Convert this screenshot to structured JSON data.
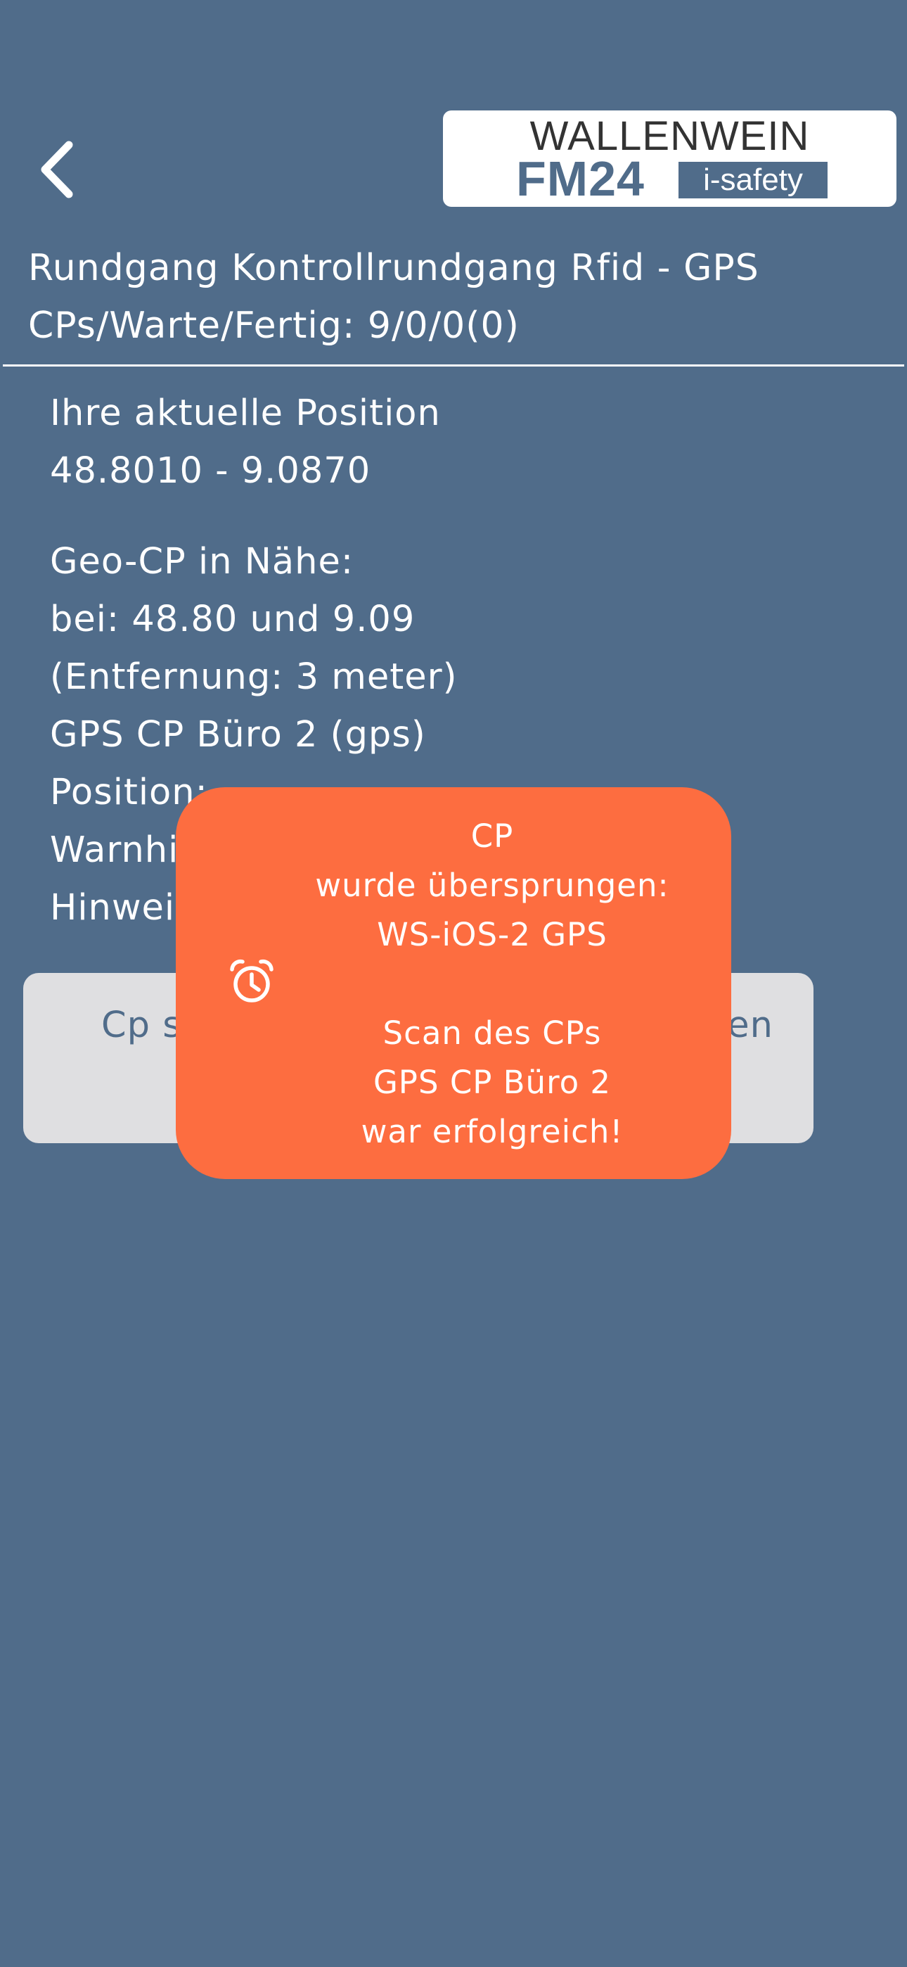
{
  "logo": {
    "brand": "WALLENWEIN",
    "product": "FM24",
    "badge": "i-safety"
  },
  "header": {
    "round_title": "Rundgang Kontrollrundgang Rfid - GPS",
    "counts": "CPs/Warte/Fertig: 9/0/0(0)"
  },
  "position": {
    "label": "Ihre aktuelle Position",
    "coords": "48.8010 - 9.0870"
  },
  "geo_cp": {
    "label": "Geo-CP in Nähe:",
    "location": "bei: 48.80 und 9.09",
    "distance": "(Entfernung: 3 meter)",
    "name": "GPS CP Büro 2 (gps)",
    "position_label": "Position:",
    "warning_label": "Warnhi",
    "hint_label": "Hinwei"
  },
  "action_button": {
    "label_left": "Cp s",
    "label_right": "en"
  },
  "toast": {
    "icon": "alarm-clock-icon",
    "line1": "CP",
    "line2": "wurde übersprungen:",
    "line3": "WS-iOS-2 GPS",
    "line4": "Scan des CPs",
    "line5": "GPS CP Büro 2",
    "line6": "war erfolgreich!",
    "color": "#fd6d40"
  },
  "colors": {
    "background": "#506c8a",
    "button_bg": "#dfdfe1",
    "text": "#ffffff"
  }
}
